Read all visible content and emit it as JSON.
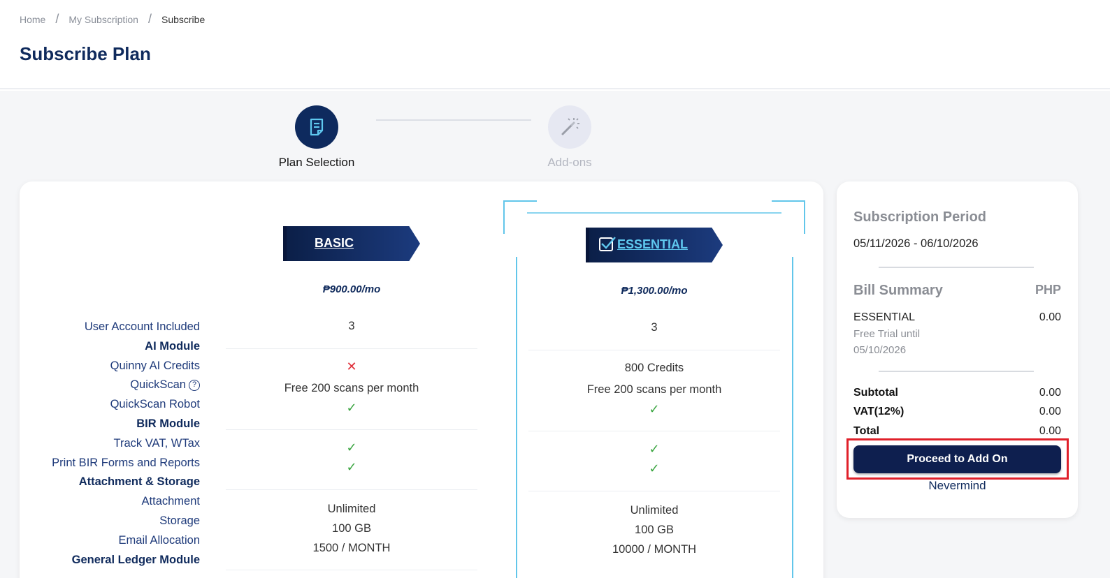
{
  "breadcrumb": {
    "home": "Home",
    "subscription": "My Subscription",
    "current": "Subscribe",
    "separator": "/"
  },
  "page": {
    "title": "Subscribe Plan"
  },
  "stepper": {
    "step1": {
      "label": "Plan Selection",
      "icon": "document-icon"
    },
    "step2": {
      "label": "Add-ons",
      "icon": "magic-wand-icon"
    }
  },
  "features": {
    "user_accounts": "User Account Included",
    "ai_module": "AI Module",
    "quinny_ai": "Quinny AI Credits",
    "quickscan": "QuickScan",
    "quickscan_help": "?",
    "quickscan_robot": "QuickScan Robot",
    "bir_module": "BIR Module",
    "track_vat": "Track VAT, WTax",
    "print_bir": "Print BIR Forms and Reports",
    "attachment_storage": "Attachment & Storage",
    "attachment": "Attachment",
    "storage": "Storage",
    "email_allocation": "Email Allocation",
    "gl_module": "General Ledger Module"
  },
  "plans": {
    "basic": {
      "name": "BASIC",
      "price": "₱900.00/mo",
      "user_accounts": "3",
      "quinny_ai": "✕",
      "quickscan": "Free 200 scans per month",
      "quickscan_robot": "✓",
      "track_vat": "✓",
      "print_bir": "✓",
      "attachment": "Unlimited",
      "storage": "100 GB",
      "email_allocation": "1500 / MONTH"
    },
    "essential": {
      "name": "ESSENTIAL",
      "price": "₱1,300.00/mo",
      "user_accounts": "3",
      "quinny_ai": "800 Credits",
      "quickscan": "Free 200 scans per month",
      "quickscan_robot": "✓",
      "track_vat": "✓",
      "print_bir": "✓",
      "attachment": "Unlimited",
      "storage": "100 GB",
      "email_allocation": "10000 / MONTH"
    }
  },
  "bill": {
    "period_title": "Subscription Period",
    "period": "05/11/2026 - 06/10/2026",
    "summary_title": "Bill Summary",
    "currency": "PHP",
    "item_name": "ESSENTIAL",
    "item_value": "0.00",
    "trial_label": "Free Trial until",
    "trial_date": "05/10/2026",
    "subtotal_label": "Subtotal",
    "subtotal": "0.00",
    "vat_label": "VAT(12%)",
    "vat": "0.00",
    "total_label": "Total",
    "total": "0.00",
    "proceed_label": "Proceed to Add On",
    "nevermind_label": "Nevermind"
  },
  "colors": {
    "brand_navy": "#0e2a5e",
    "accent_cyan": "#62c6ea",
    "check_green": "#3aa540",
    "cross_red": "#e0303a",
    "highlight_red": "#e0202a"
  }
}
